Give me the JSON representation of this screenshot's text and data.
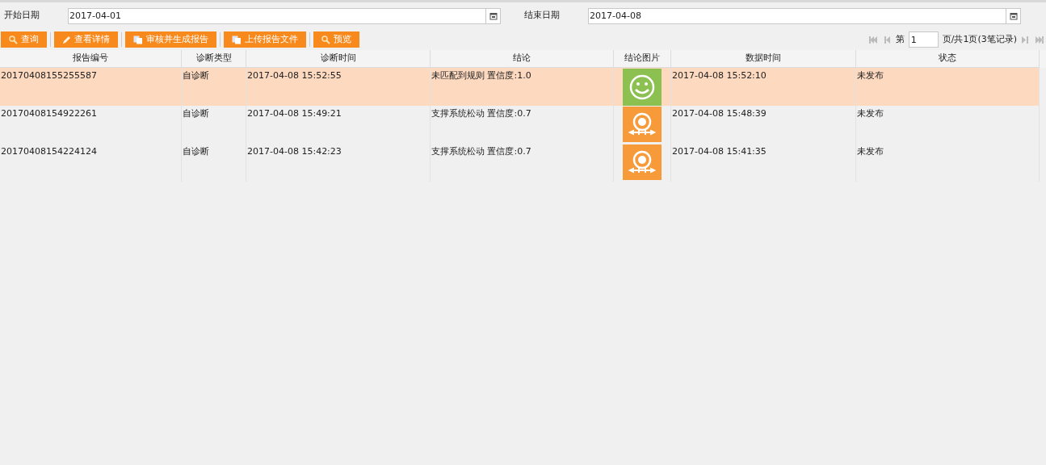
{
  "filters": [
    {
      "label": "开始日期",
      "value": "2017-04-01"
    },
    {
      "label": "结束日期",
      "value": "2017-04-08"
    }
  ],
  "toolbar": [
    {
      "label": "查询",
      "kind": "search"
    },
    {
      "label": "查看详情",
      "kind": "edit"
    },
    {
      "label": "审核并生成报告",
      "kind": "copy"
    },
    {
      "label": "上传报告文件",
      "kind": "copy"
    },
    {
      "label": "预览",
      "kind": "search"
    }
  ],
  "pager": {
    "prefix": "第",
    "page": "1",
    "suffix": "页/共1页(3笔记录)"
  },
  "table": {
    "columns": [
      "报告编号",
      "诊断类型",
      "诊断时间",
      "结论",
      "结论图片",
      "数据时间",
      "状态"
    ],
    "rows": [
      {
        "selected": true,
        "cells": [
          "20170408155255587",
          "自诊断",
          "2017-04-08 15:52:55",
          "未匹配到规则 置信度:1.0",
          {
            "kind": "smile"
          },
          "2017-04-08 15:52:10",
          "未发布"
        ]
      },
      {
        "selected": false,
        "cells": [
          "20170408154922261",
          "自诊断",
          "2017-04-08 15:49:21",
          "支撑系统松动 置信度:0.7",
          {
            "kind": "motor"
          },
          "2017-04-08 15:48:39",
          "未发布"
        ]
      },
      {
        "selected": false,
        "cells": [
          "20170408154224124",
          "自诊断",
          "2017-04-08 15:42:23",
          "支撑系统松动 置信度:0.7",
          {
            "kind": "motor"
          },
          "2017-04-08 15:41:35",
          "未发布"
        ]
      }
    ]
  }
}
